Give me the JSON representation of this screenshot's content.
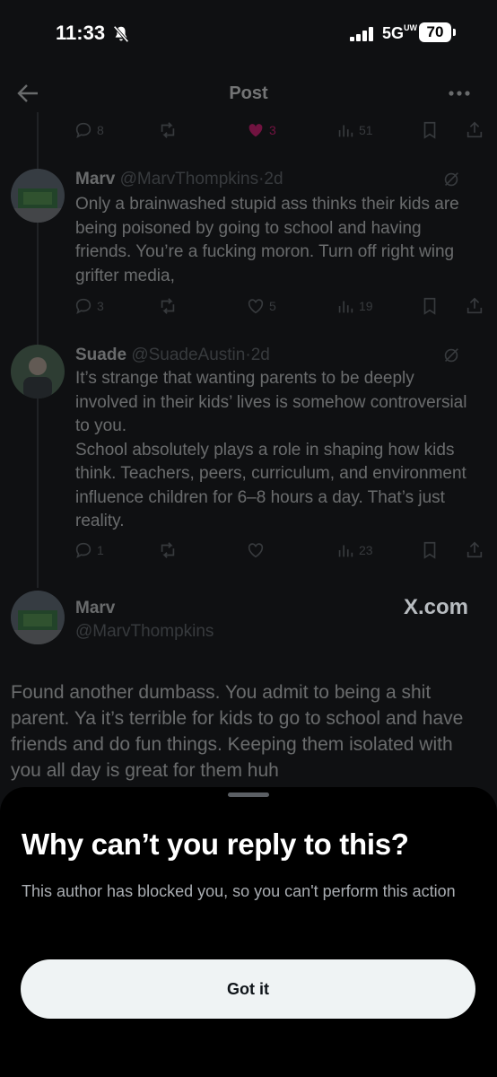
{
  "status_bar": {
    "time": "11:33",
    "network": "5G",
    "network_sub": "UW",
    "battery": "70"
  },
  "header": {
    "title": "Post"
  },
  "top_actions": {
    "replies": "8",
    "likes": "3",
    "views": "51",
    "liked_color": "#f91880"
  },
  "tweets": [
    {
      "name": "Marv",
      "handle": "@MarvThompkins",
      "time": "2d",
      "text": "Only a brainwashed stupid ass thinks their kids are being poisoned by going to school and having friends. You’re  a fucking moron. Turn off right wing grifter media,",
      "replies": "3",
      "likes": "5",
      "views": "19"
    },
    {
      "name": "Suade",
      "handle": "@SuadeAustin",
      "time": "2d",
      "text": "It’s strange that wanting parents to be deeply involved in their kids’ lives is somehow controversial to you.",
      "text2": "School absolutely plays a role in shaping how kids think. Teachers, peers, curriculum, and environment influence children for 6–8 hours a day. That’s just reality.",
      "replies": "1",
      "views": "23"
    }
  ],
  "focused_post": {
    "name": "Marv",
    "handle": "@MarvThompkins",
    "watermark": "X.com",
    "text": "Found another dumbass. You admit to being a shit parent. Ya it’s terrible for kids to go to school and have friends and do fun things. Keeping them isolated with you all day is great for them huh"
  },
  "sheet": {
    "title": "Why can’t you reply to this?",
    "description": "This author has blocked you, so you can't perform this action",
    "button_label": "Got it"
  }
}
